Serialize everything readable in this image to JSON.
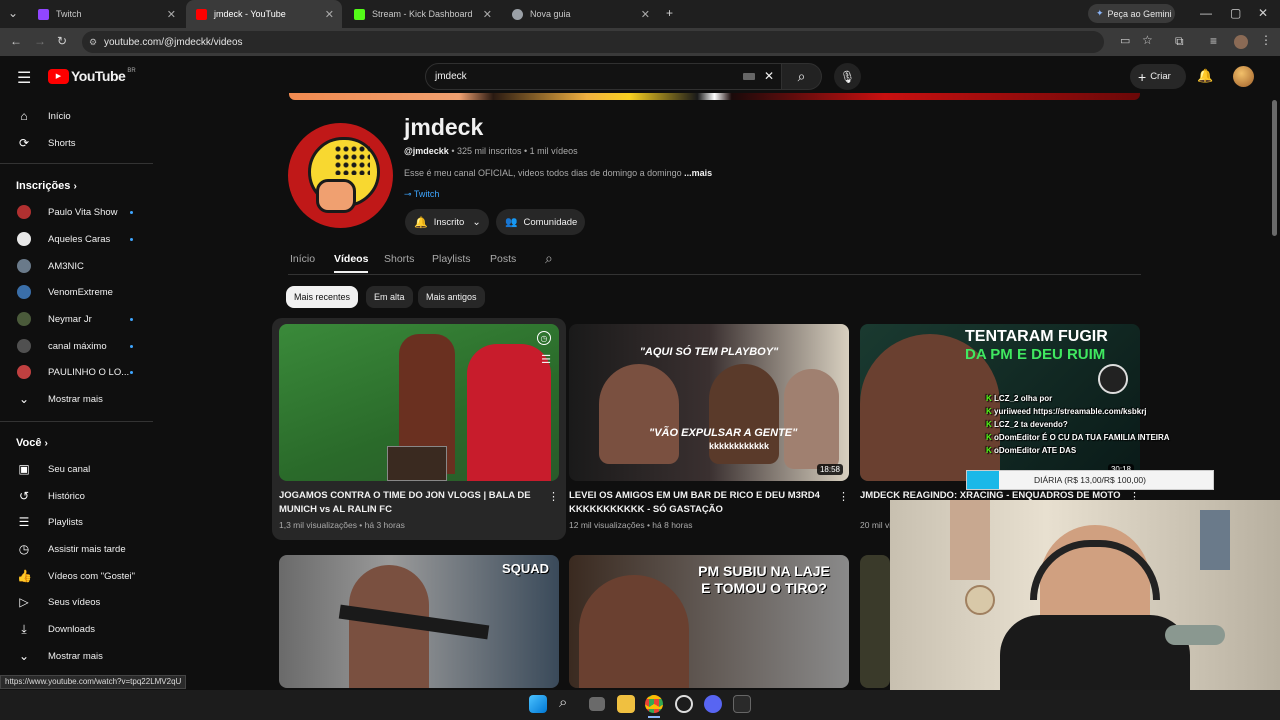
{
  "browser": {
    "tabs": [
      {
        "title": "Twitch",
        "color": "#9146ff"
      },
      {
        "title": "jmdeck - YouTube",
        "color": "#ff0000"
      },
      {
        "title": "Stream - Kick Dashboard",
        "color": "#53fc18"
      },
      {
        "title": "Nova guia",
        "color": "#9aa0a6"
      }
    ],
    "gemini_label": "Peça ao Gemini",
    "url": "youtube.com/@jmdeckk/videos"
  },
  "header": {
    "logo_text": "YouTube",
    "country": "BR",
    "search_value": "jmdeck",
    "create_label": "Criar"
  },
  "sidebar": {
    "top": [
      {
        "label": "Início",
        "icon": "home-icon"
      },
      {
        "label": "Shorts",
        "icon": "shorts-icon"
      }
    ],
    "subs_heading": "Inscrições",
    "subs": [
      {
        "label": "Paulo Vita Show",
        "color": "#b03030",
        "dot": true
      },
      {
        "label": "Aqueles Caras",
        "color": "#e8e8e8",
        "dot": true
      },
      {
        "label": "AM3NIC",
        "color": "#6a7a8a",
        "dot": false
      },
      {
        "label": "VenomExtreme",
        "color": "#3a6ea8",
        "dot": false
      },
      {
        "label": "Neymar Jr",
        "color": "#4a5a3a",
        "dot": true
      },
      {
        "label": "canal máximo",
        "color": "#505050",
        "dot": true
      },
      {
        "label": "PAULINHO O LO...",
        "color": "#c04040",
        "dot": true
      }
    ],
    "subs_more": "Mostrar mais",
    "you_heading": "Você",
    "you": [
      {
        "label": "Seu canal",
        "icon": "channel-icon"
      },
      {
        "label": "Histórico",
        "icon": "history-icon"
      },
      {
        "label": "Playlists",
        "icon": "playlists-icon"
      },
      {
        "label": "Assistir mais tarde",
        "icon": "clock-icon"
      },
      {
        "label": "Vídeos com \"Gostei\"",
        "icon": "like-icon"
      },
      {
        "label": "Seus vídeos",
        "icon": "video-icon"
      },
      {
        "label": "Downloads",
        "icon": "download-icon"
      }
    ],
    "you_more": "Mostrar mais"
  },
  "channel": {
    "name": "jmdeck",
    "handle": "@jmdeckk",
    "stats": " • 325 mil inscritos • 1 mil vídeos",
    "description": "Esse é meu canal OFICIAL, videos todos dias de domingo a domingo",
    "more": "...mais",
    "link": "Twitch",
    "subscribed_label": "Inscrito",
    "community_label": "Comunidade"
  },
  "channel_tabs": [
    "Início",
    "Vídeos",
    "Shorts",
    "Playlists",
    "Posts"
  ],
  "filters": [
    "Mais recentes",
    "Em alta",
    "Mais antigos"
  ],
  "videos": [
    {
      "title": "JOGAMOS CONTRA O TIME DO JON VLOGS | BALA DE MUNICH vs AL RALIN FC",
      "meta": "1,3 mil visualizações • há 3 horas",
      "duration": ""
    },
    {
      "title": "LEVEI OS AMIGOS EM UM BAR DE RICO E DEU M3RD4 KKKKKKKKKKK - SÓ GASTAÇÃO",
      "meta": "12 mil visualizações • há 8 horas",
      "duration": "18:58"
    },
    {
      "title": "JMDECK REAGINDO: XRACING - ENQUADROS DE MOTO",
      "meta": "20 mil vi",
      "duration": "30:18"
    }
  ],
  "thumb_text": {
    "v2_top": "\"AQUI SÓ TEM PLAYBOY\"",
    "v2_bottom": "\"VÃO EXPULSAR A GENTE\"",
    "v2_k": "kkkkkkkkkkkk",
    "v3_line1": "TENTARAM FUGIR",
    "v3_line2": "DA PM E DEU RUIM",
    "v4": "SQUAD",
    "v5_line1": "PM SUBIU NA LAJE",
    "v5_line2": "E TOMOU O TIRO?"
  },
  "overlay": {
    "chat": [
      {
        "user": "LCZ_2",
        "msg": "olha por"
      },
      {
        "user": "yuriiweed",
        "msg": "https://streamable.com/ksbkrj"
      },
      {
        "user": "LCZ_2",
        "msg": "ta devendo?"
      },
      {
        "user": "oDomEditor",
        "msg": "É O CU DA TUA FAMILIA INTEIRA"
      },
      {
        "user": "oDomEditor",
        "msg": "ATE DAS"
      }
    ],
    "goal_label": "DIÁRIA (R$ 13,00/R$ 100,00)",
    "goal_progress": 0.13
  },
  "status_url": "https://www.youtube.com/watch?v=tpq22LMV2qU"
}
